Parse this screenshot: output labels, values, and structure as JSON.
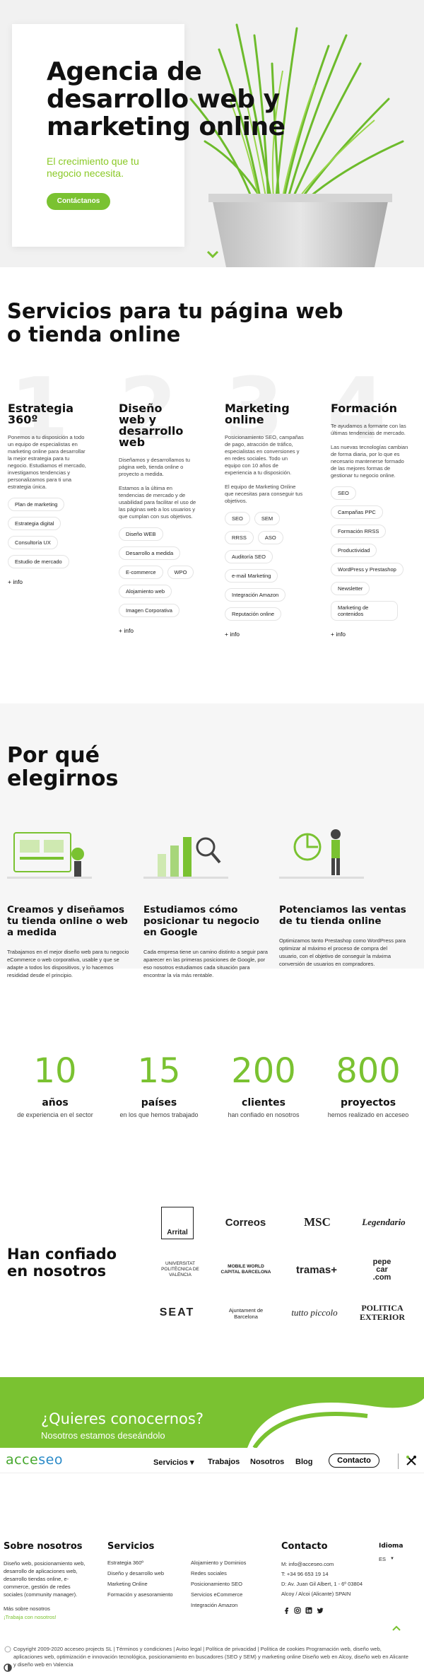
{
  "hero": {
    "title": "Agencia de desarrollo web y marketing online",
    "subtitle": "El crecimiento que tu negocio necesita.",
    "cta": "Contáctanos"
  },
  "services": {
    "title": "Servicios para tu página web o tienda online",
    "numbers": [
      "1",
      "2",
      "3",
      "4"
    ],
    "columns": [
      {
        "title": "Estrategia 360º",
        "paragraphs": [
          "Ponemos a tu disposición a todo un equipo de especialistas en marketing online para desarrollar la mejor estrategia para tu negocio. Estudiamos el mercado, investigamos tendencias y personalizamos para ti una estrategia única."
        ],
        "tags": [
          "Plan de marketing",
          "Estrategia digital",
          "Consultoría UX",
          "Estudio de mercado"
        ],
        "more": "+ info"
      },
      {
        "title": "Diseño web y desarrollo web",
        "paragraphs": [
          "Diseñamos y desarrollamos tu página web, tienda online o proyecto a medida.",
          "Estamos a la última en tendencias de mercado y de usabilidad para facilitar el uso de las páginas web a los usuarios y que cumplan con sus objetivos."
        ],
        "tags": [
          "Diseño WEB",
          "Desarrollo a medida",
          "E-commerce",
          "WPO",
          "Alojamiento web",
          "Imagen Corporativa"
        ],
        "more": "+ info"
      },
      {
        "title": "Marketing online",
        "paragraphs": [
          "Posicionamiento SEO, campañas de pago, atracción de tráfico, especialistas en conversiones y en redes sociales. Todo un equipo con 10 años de experiencia a tu disposición.",
          "El equipo de Marketing Online que necesitas para conseguir tus objetivos."
        ],
        "tags": [
          "SEO",
          "SEM",
          "RRSS",
          "ASO",
          "Auditoría SEO",
          "e-mail Marketing",
          "Integración Amazon",
          "Reputación online"
        ],
        "more": "+ info"
      },
      {
        "title": "Formación",
        "paragraphs": [
          "Te ayudamos a formarte con las últimas tendencias de mercado.",
          "Las nuevas tecnologías cambian de forma diaria, por lo que es necesario mantenerse formado de las mejores formas de gestionar tu negocio online."
        ],
        "tags": [
          "SEO",
          "Campañas PPC",
          "Formación RRSS",
          "Productividad",
          "WordPress y Prestashop",
          "Newsletter",
          "Marketing de contenidos"
        ],
        "more": "+ info"
      }
    ]
  },
  "why": {
    "title": "Por qué elegirnos",
    "items": [
      {
        "title": "Creamos y diseñamos tu tienda online o web a medida",
        "text": "Trabajamos en el mejor diseño web para tu negocio eCommerce o web corporativa, usable y que se adapte a todos los dispositivos, y lo hacemos resididad desde el principio."
      },
      {
        "title": "Estudiamos cómo posicionar tu negocio en Google",
        "text": "Cada empresa tiene un camino distinto a seguir para aparecer en las primeras posiciones de Google, por eso nosotros estudiamos cada situación para encontrar la vía más rentable."
      },
      {
        "title": "Potenciamos las ventas de tu tienda online",
        "text": "Optimizamos tanto Prestashop como WordPress para optimizar al máximo el proceso de compra del usuario, con el objetivo de conseguir la máxima conversión de usuarios en compradores."
      }
    ]
  },
  "stats": [
    {
      "number": "10",
      "label": "años",
      "desc": "de experiencia en el sector"
    },
    {
      "number": "15",
      "label": "países",
      "desc": "en los que hemos trabajado"
    },
    {
      "number": "200",
      "label": "clientes",
      "desc": "han confiado en nosotros"
    },
    {
      "number": "800",
      "label": "proyectos",
      "desc": "hemos realizado en acceseo"
    }
  ],
  "trust": {
    "title": "Han confiado en nosotros",
    "logos": [
      "Arrital",
      "Correos",
      "MSC",
      "Legendario",
      "UNIVERSITAT POLITÈCNICA DE VALÈNCIA",
      "MOBILE WORLD CAPITAL BARCELONA",
      "tramas+",
      "pepe car .com",
      "SEAT",
      "Ajuntament de Barcelona",
      "tutto piccolo",
      "POLITICA EXTERIOR"
    ]
  },
  "band": {
    "question": "¿Quieres conocernos?",
    "sub": "Nosotros estamos deseándolo"
  },
  "nav": {
    "brand_a": "acce",
    "brand_b": "seo",
    "items": [
      "Servicios ▾",
      "Trabajos",
      "Nosotros",
      "Blog"
    ],
    "contact": "Contacto"
  },
  "footer": {
    "about_title": "Sobre nosotros",
    "about_text": "Diseño web, posicionamiento web, desarrollo de aplicaciones web, desarrollo tiendas online, e-commerce, gestión de redes sociales (community manager).",
    "about_link1": "Más sobre nosotros",
    "about_link2": "¡Trabaja con nosotros!",
    "services_title": "Servicios",
    "services_col1": [
      "Estrategia 360º",
      "Diseño y desarrollo web",
      "Marketing Online",
      "Formación y asesoramiento"
    ],
    "services_col2": [
      "Alojamiento y Dominios",
      "Redes sociales",
      "Posicionamiento SEO",
      "Servicios eCommerce",
      "Integración Amazon"
    ],
    "contact_title": "Contacto",
    "contact_lines": [
      "M: info@acceseo.com",
      "T: +34 96 653 19 14",
      "D: Av. Juan Gil Albert, 1 - 6º 03804",
      "Alcoy / Alcoi (Alicante) SPAIN"
    ],
    "lang_title": "Idioma",
    "lang_value": "ES",
    "copyright": "Copyright 2009-2020 acceseo projects SL | Términos y condiciones | Aviso legal | Política de privacidad | Política de cookies Programación web, diseño web, aplicaciones web, optimización e innovación tecnológica, posicionamiento en buscadores (SEO y SEM) y marketing online Diseño web en Alcoy, diseño web en Alicante y diseño web en Valencia"
  },
  "colors": {
    "accent": "#7ac231",
    "brand_green": "#47a82f",
    "brand_blue": "#2a8ac8"
  },
  "icons": [
    "chevron-down-icon",
    "facebook-icon",
    "instagram-icon",
    "linkedin-icon",
    "twitter-icon",
    "arrow-up-icon",
    "accessibility-icon",
    "tools-icon"
  ]
}
